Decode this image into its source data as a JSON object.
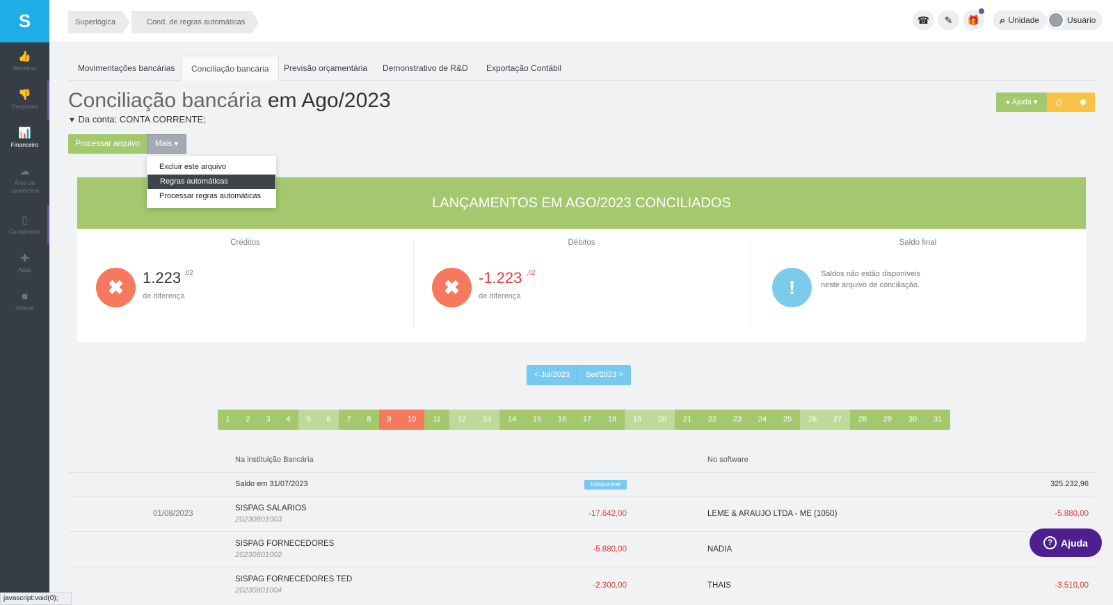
{
  "sidebar": {
    "logo": "S",
    "items": [
      {
        "label": "Receitas",
        "icon": "thumbs-up-icon",
        "glyph": "👍"
      },
      {
        "label": "Despesas",
        "icon": "thumbs-down-icon",
        "glyph": "👎"
      },
      {
        "label": "Financeiro",
        "icon": "bar-chart-icon",
        "glyph": "📊"
      },
      {
        "label": "Área do condômino",
        "icon": "cloud-icon",
        "glyph": "☁"
      },
      {
        "label": "Condomínio",
        "icon": "building-icon",
        "glyph": "▯"
      },
      {
        "label": "Apps",
        "icon": "puzzle-icon",
        "glyph": "✚"
      },
      {
        "label": "Vídeos",
        "icon": "video-camera-icon",
        "glyph": "■"
      }
    ]
  },
  "breadcrumb": [
    "Superlógica",
    "Cond. de regras automáticas"
  ],
  "topbar": {
    "phone_glyph": "☎",
    "ticket_glyph": "✎",
    "gift_glyph": "🎁",
    "search_glyph": "⌕",
    "unit_label": "Unidade",
    "user_label": "Usuário"
  },
  "tabs": [
    "Movimentações bancárias",
    "Conciliação bancária",
    "Previsão orçamentária",
    "Demonstrativo de R&D",
    "Exportação Contábil"
  ],
  "page": {
    "title_main": "Conciliação bancária",
    "title_rest": " em Ago/2023",
    "filter": "Da conta: CONTA CORRENTE;",
    "filter_glyph": "▼"
  },
  "actions": {
    "process": "Processar arquivo",
    "more": "Mais ▾",
    "help": "● Ajuda ▾",
    "print_glyph": "⎙",
    "gear_glyph": "✹"
  },
  "dropdown": [
    "Excluir este arquivo",
    "Regras automáticas",
    "Processar regras automáticas"
  ],
  "banner": "LANÇAMENTOS EM AGO/2023 CONCILIADOS",
  "summary": {
    "credits": {
      "label": "Créditos",
      "value": "1.223",
      "cents": ",02",
      "sub": "de diferença",
      "glyph": "✖"
    },
    "debits": {
      "label": "Débitos",
      "value": "-1.223",
      "cents": ",02",
      "sub": "de diferença",
      "glyph": "✖"
    },
    "final": {
      "label": "Saldo final",
      "note": "Saldos não estão disponíveis neste arquivo de conciliação.",
      "glyph": "!"
    }
  },
  "month_nav": {
    "prev": "< Jul/2023",
    "next": "Set/2023 >"
  },
  "days": [
    {
      "n": "1",
      "color": "#a3c86d"
    },
    {
      "n": "2",
      "color": "#a3c86d"
    },
    {
      "n": "3",
      "color": "#a3c86d"
    },
    {
      "n": "4",
      "color": "#a3c86d"
    },
    {
      "n": "5",
      "color": "#bfd99a"
    },
    {
      "n": "6",
      "color": "#bfd99a"
    },
    {
      "n": "7",
      "color": "#a3c86d"
    },
    {
      "n": "8",
      "color": "#a3c86d"
    },
    {
      "n": "9",
      "color": "#f6795e"
    },
    {
      "n": "10",
      "color": "#f6795e"
    },
    {
      "n": "11",
      "color": "#a3c86d"
    },
    {
      "n": "12",
      "color": "#bfd99a"
    },
    {
      "n": "13",
      "color": "#bfd99a"
    },
    {
      "n": "14",
      "color": "#a3c86d"
    },
    {
      "n": "15",
      "color": "#a3c86d"
    },
    {
      "n": "16",
      "color": "#a3c86d"
    },
    {
      "n": "17",
      "color": "#a3c86d"
    },
    {
      "n": "18",
      "color": "#a3c86d"
    },
    {
      "n": "19",
      "color": "#bfd99a"
    },
    {
      "n": "20",
      "color": "#bfd99a"
    },
    {
      "n": "21",
      "color": "#a3c86d"
    },
    {
      "n": "22",
      "color": "#a3c86d"
    },
    {
      "n": "23",
      "color": "#a3c86d"
    },
    {
      "n": "24",
      "color": "#a3c86d"
    },
    {
      "n": "25",
      "color": "#a3c86d"
    },
    {
      "n": "26",
      "color": "#bfd99a"
    },
    {
      "n": "27",
      "color": "#bfd99a"
    },
    {
      "n": "28",
      "color": "#a3c86d"
    },
    {
      "n": "29",
      "color": "#a3c86d"
    },
    {
      "n": "30",
      "color": "#a3c86d"
    },
    {
      "n": "31",
      "color": "#a3c86d"
    }
  ],
  "table": {
    "bank_header": "Na instituição Bancária",
    "software_header": "No software",
    "opening": {
      "label": "Saldo em 31/07/2023",
      "badge": "Indisponível",
      "software_value": "325.232,96"
    },
    "rows": [
      {
        "date": "01/08/2023",
        "desc": "SISPAG SALARIOS",
        "doc": "20230801003",
        "bank_value": "-17.642,00",
        "software_desc": "LEME & ARAUJO LTDA - ME (1050)",
        "software_value": "-5.880,00"
      },
      {
        "date": "",
        "desc": "SISPAG FORNECEDORES",
        "doc": "20230801002",
        "bank_value": "-5.880,00",
        "software_desc": "NADIA",
        "software_value": ""
      },
      {
        "date": "",
        "desc": "SISPAG FORNECEDORES TED",
        "doc": "20230801004",
        "bank_value": "-2.300,00",
        "software_desc": "THAIS",
        "software_value": "-3.510,00"
      }
    ]
  },
  "float_help": {
    "label": "Ajuda",
    "glyph": "?"
  },
  "status_bar": "javascript:void(0);"
}
